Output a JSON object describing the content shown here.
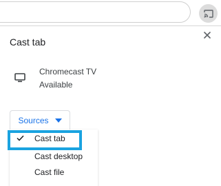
{
  "dialog": {
    "title": "Cast tab",
    "device": {
      "name": "Chromecast TV",
      "status": "Available",
      "icon": "monitor-icon"
    }
  },
  "sources": {
    "label": "Sources",
    "items": [
      {
        "label": "Cast tab",
        "selected": true
      },
      {
        "label": "Cast desktop",
        "selected": false
      },
      {
        "label": "Cast file",
        "selected": false
      }
    ]
  },
  "colors": {
    "accent": "#1a73e8",
    "highlight": "#1aa3e0",
    "text": "#202124"
  }
}
